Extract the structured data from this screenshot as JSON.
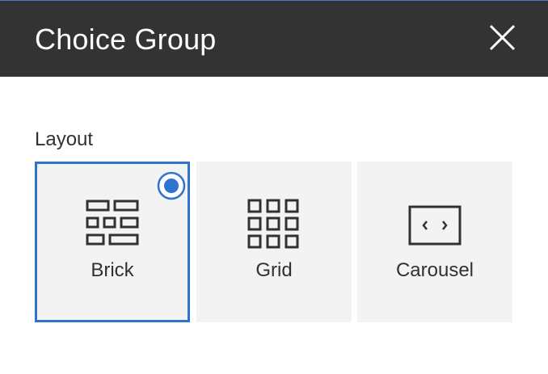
{
  "panel": {
    "title": "Choice Group",
    "close_icon": "close-icon"
  },
  "group": {
    "label": "Layout",
    "options": [
      {
        "label": "Brick",
        "icon": "brick-layout-icon",
        "selected": true
      },
      {
        "label": "Grid",
        "icon": "grid-layout-icon",
        "selected": false
      },
      {
        "label": "Carousel",
        "icon": "carousel-layout-icon",
        "selected": false
      }
    ]
  },
  "colors": {
    "header_bg": "#333333",
    "accent": "#2f73d1",
    "tile_bg": "#f3f3f3",
    "text": "#323130"
  }
}
